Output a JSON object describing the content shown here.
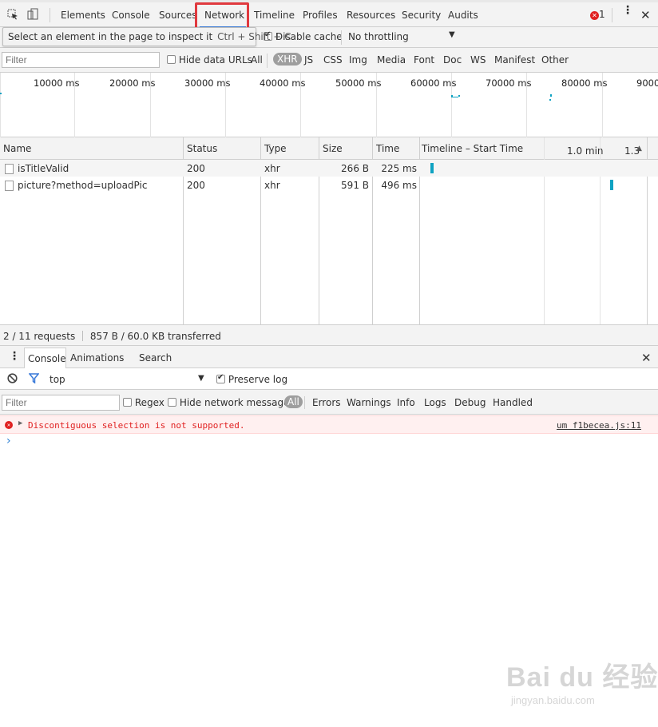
{
  "tabs": [
    "Elements",
    "Console",
    "Sources",
    "Network",
    "Timeline",
    "Profiles",
    "Resources",
    "Security",
    "Audits"
  ],
  "active_tab": "Network",
  "error_count": "1",
  "inspect_tooltip": {
    "text": "Select an element in the page to inspect it",
    "shortcut": "Ctrl + Shift + C"
  },
  "toolbar": {
    "disable_cache": "Disable cache",
    "throttling": "No throttling"
  },
  "filter": {
    "placeholder": "Filter",
    "hide_data_urls": "Hide data URLs",
    "types": [
      "All",
      "XHR",
      "JS",
      "CSS",
      "Img",
      "Media",
      "Font",
      "Doc",
      "WS",
      "Manifest",
      "Other"
    ],
    "selected_type": "XHR"
  },
  "overview": {
    "ticks": [
      "10000 ms",
      "20000 ms",
      "30000 ms",
      "40000 ms",
      "50000 ms",
      "60000 ms",
      "70000 ms",
      "80000 ms",
      "9000"
    ]
  },
  "grid": {
    "headers": {
      "name": "Name",
      "status": "Status",
      "type": "Type",
      "size": "Size",
      "time": "Time",
      "timeline": "Timeline – Start Time",
      "t1": "1.0 min",
      "t2": "1.3"
    },
    "rows": [
      {
        "name": "isTitleValid",
        "status": "200",
        "type": "xhr",
        "size": "266 B",
        "time": "225 ms"
      },
      {
        "name": "picture?method=uploadPic",
        "status": "200",
        "type": "xhr",
        "size": "591 B",
        "time": "496 ms"
      }
    ]
  },
  "statusbar": {
    "requests": "2 / 11 requests",
    "transferred": "857 B / 60.0 KB transferred"
  },
  "drawer": {
    "tabs": [
      "Console",
      "Animations",
      "Search"
    ],
    "active": "Console"
  },
  "console": {
    "context": "top",
    "preserve_log": "Preserve log",
    "filter_placeholder": "Filter",
    "regex": "Regex",
    "hide_network": "Hide network messages",
    "levels": [
      "All",
      "Errors",
      "Warnings",
      "Info",
      "Logs",
      "Debug",
      "Handled"
    ],
    "selected_level": "All",
    "messages": [
      {
        "text": "Discontiguous selection is not supported.",
        "source": "um f1becea.js:11"
      }
    ]
  },
  "watermark": {
    "brand": "Bai du 经验",
    "url": "jingyan.baidu.com"
  },
  "colors": {
    "accent": "#3879d9",
    "highlight_box": "#e0393e",
    "error": "#e02020",
    "bar": "#0ea2c2"
  }
}
